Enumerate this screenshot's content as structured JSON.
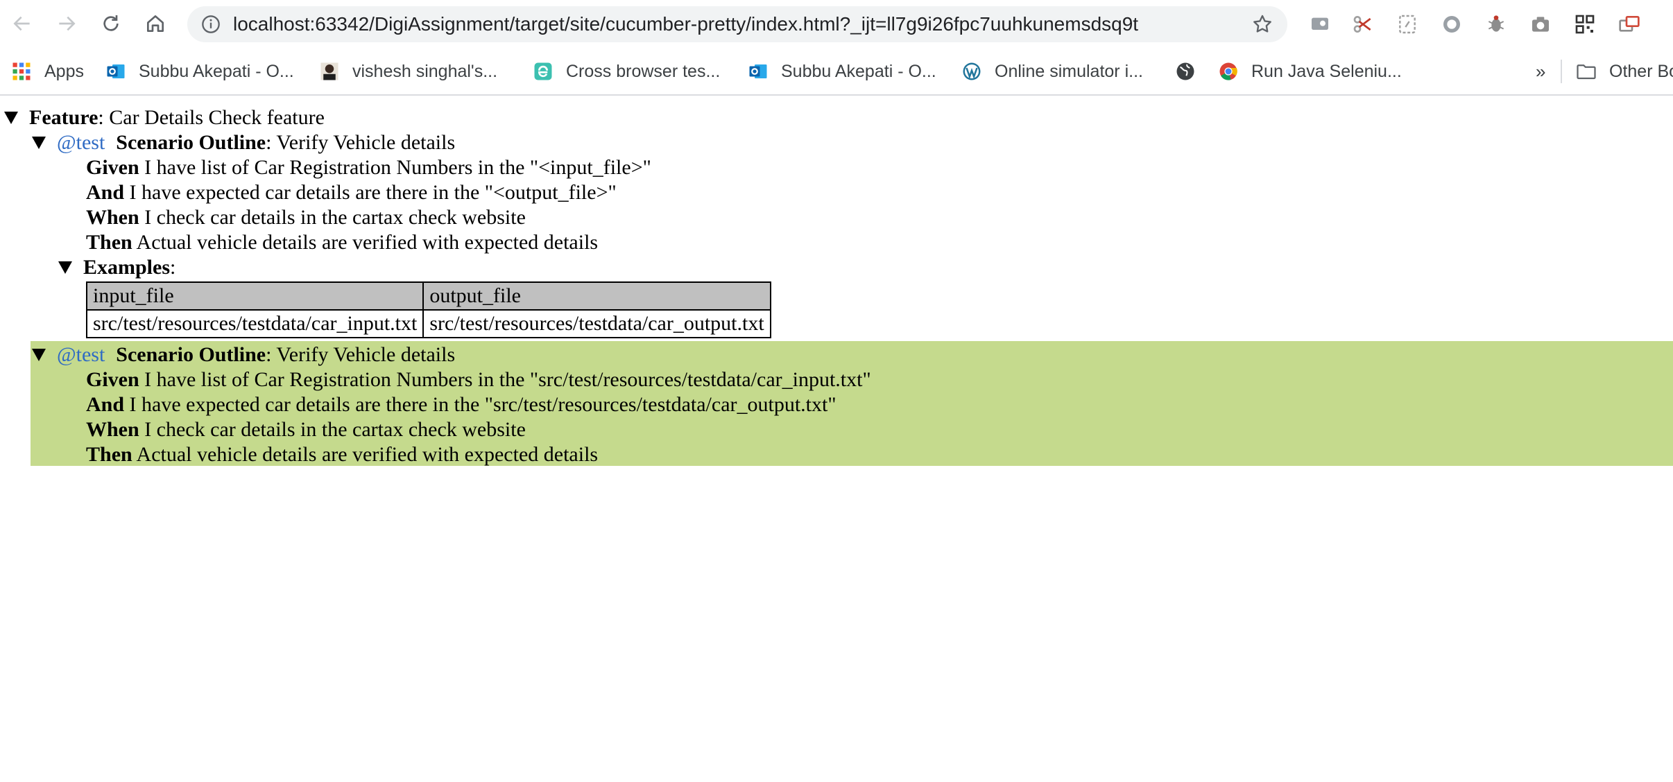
{
  "browser": {
    "url": "localhost:63342/DigiAssignment/target/site/cucumber-pretty/index.html?_ijt=ll7g9i26fpc7uuhkunemsdsq9t",
    "bookmarks": [
      {
        "label": "Apps",
        "icon": "apps-grid-icon"
      },
      {
        "label": "Subbu Akepati - O...",
        "icon": "outlook-icon"
      },
      {
        "label": "vishesh singhal's...",
        "icon": "avatar-icon"
      },
      {
        "label": "Cross browser tes...",
        "icon": "e-logo-icon"
      },
      {
        "label": "Subbu Akepati - O...",
        "icon": "outlook-icon"
      },
      {
        "label": "Online simulator i...",
        "icon": "wordpress-icon"
      },
      {
        "label": "",
        "icon": "globe-icon"
      },
      {
        "label": "Run Java Seleniu...",
        "icon": "chrome-icon"
      }
    ],
    "overflow": "»",
    "other_bookmarks": "Other Bo"
  },
  "report": {
    "feature": {
      "keyword": "Feature",
      "name": ": Car Details Check feature"
    },
    "outline": {
      "tag": "@test",
      "keyword": "Scenario Outline",
      "name": ": Verify Vehicle details",
      "steps": [
        {
          "keyword": "Given",
          "text": " I have list of Car Registration Numbers in the \"<input_file>\""
        },
        {
          "keyword": "And",
          "text": " I have expected car details are there in the \"<output_file>\""
        },
        {
          "keyword": "When",
          "text": " I check car details in the cartax check website"
        },
        {
          "keyword": "Then",
          "text": " Actual vehicle details are verified with expected details"
        }
      ],
      "examples": {
        "keyword": "Examples",
        "suffix": ":",
        "headers": [
          "input_file",
          "output_file"
        ],
        "rows": [
          [
            "src/test/resources/testdata/car_input.txt",
            "src/test/resources/testdata/car_output.txt"
          ]
        ]
      }
    },
    "scenario": {
      "tag": "@test",
      "keyword": "Scenario Outline",
      "name": ": Verify Vehicle details",
      "status_color": "#c5da8d",
      "steps": [
        {
          "keyword": "Given",
          "text": " I have list of Car Registration Numbers in the \"src/test/resources/testdata/car_input.txt\""
        },
        {
          "keyword": "And",
          "text": " I have expected car details are there in the \"src/test/resources/testdata/car_output.txt\""
        },
        {
          "keyword": "When",
          "text": " I check car details in the cartax check website"
        },
        {
          "keyword": "Then",
          "text": " Actual vehicle details are verified with expected details"
        }
      ]
    }
  }
}
